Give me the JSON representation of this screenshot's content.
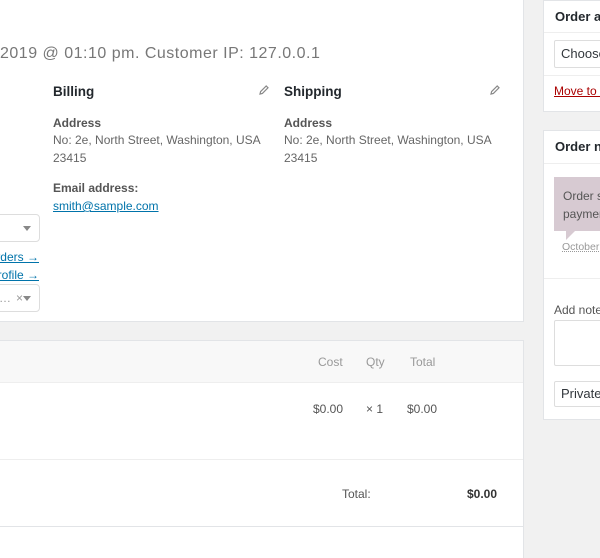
{
  "order": {
    "meta_line": "2019 @ 01:10 pm. Customer IP: 127.0.0.1"
  },
  "billing": {
    "title": "Billing",
    "address_label": "Address",
    "address_line1": "No: 2e, North Street, Washington, USA",
    "address_line2": "23415",
    "email_label": "Email address:",
    "email": "smith@sample.com"
  },
  "shipping": {
    "title": "Shipping",
    "address_label": "Address",
    "address_line1": "No: 2e, North Street, Washington, USA",
    "address_line2": "23415"
  },
  "customer": {
    "orders_link": "rders →",
    "profile_link": "Profile →",
    "select_value": "…",
    "clear_symbol": "×"
  },
  "items": {
    "columns": {
      "cost": "Cost",
      "qty": "Qty",
      "total": "Total"
    },
    "rows": [
      {
        "cost": "$0.00",
        "qty": "× 1",
        "total": "$0.00"
      }
    ],
    "totals": {
      "label": "Total:",
      "value": "$0.00"
    }
  },
  "sidebar": {
    "order_actions": {
      "title": "Order ac",
      "select_value": "Choose",
      "move_link": "Move to t"
    },
    "order_notes": {
      "title": "Order no",
      "note_line1": "Order s",
      "note_line2": "paymen",
      "note_date": "October",
      "add_note_label": "Add note",
      "note_type_value": "Private"
    }
  }
}
